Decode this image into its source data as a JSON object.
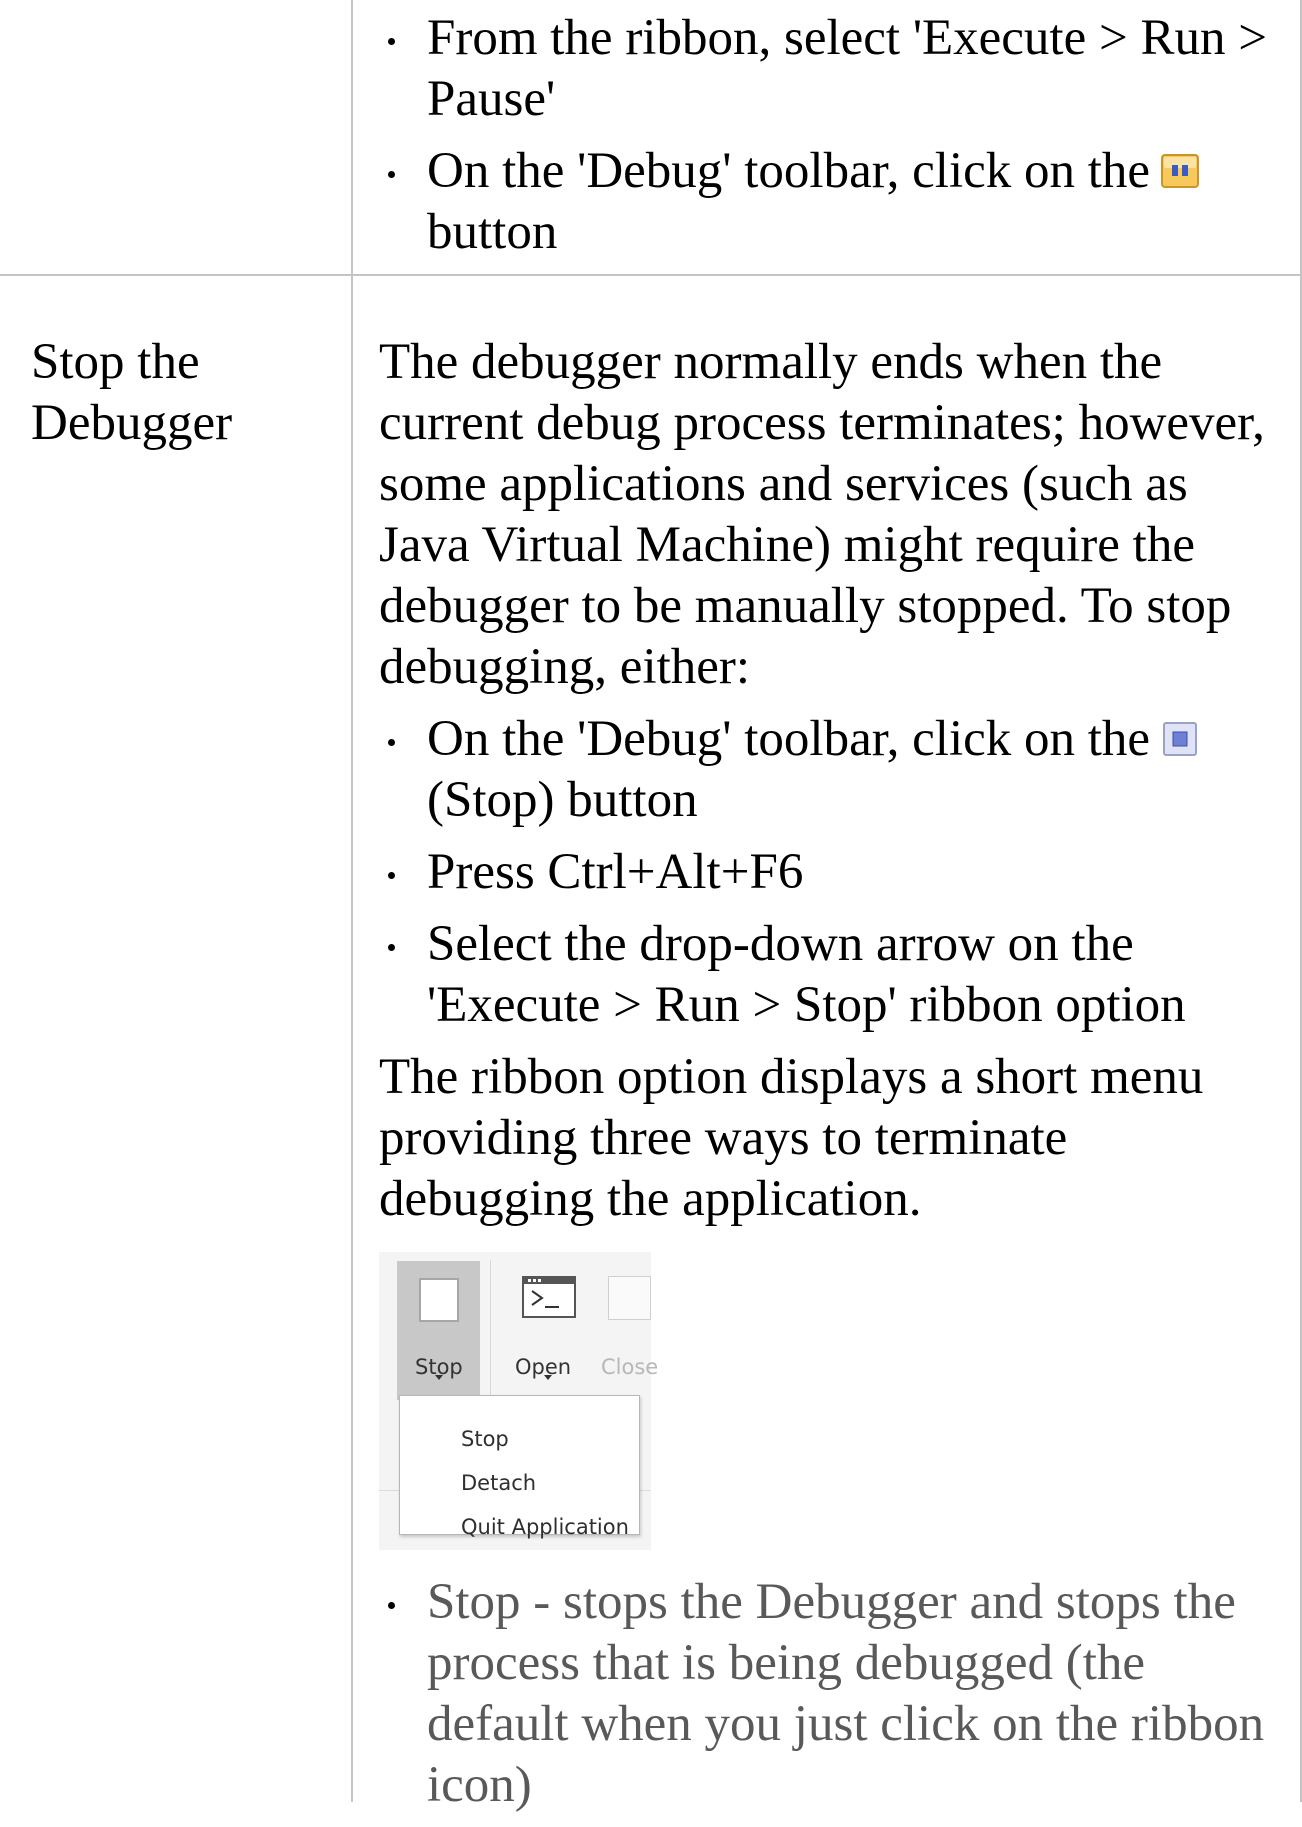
{
  "row1": {
    "bullets": [
      {
        "text": "From the ribbon, select 'Execute > Run > Pause'"
      },
      {
        "text_before": "On the 'Debug' toolbar, click on the",
        "icon": "pause-icon",
        "text_after": "button"
      }
    ]
  },
  "row2": {
    "label": "Stop the Debugger",
    "intro": "The debugger normally ends when the current debug process terminates; however, some applications and services (such as Java Virtual Machine) might require the debugger to be manually stopped. To stop debugging, either:",
    "bullets": [
      {
        "text_before": "On the 'Debug' toolbar, click on the",
        "icon": "stop-icon",
        "text_after": "(Stop) button"
      },
      {
        "text": "Press Ctrl+Alt+F6"
      },
      {
        "text": "Select the drop-down arrow on the 'Execute > Run > Stop' ribbon option"
      }
    ],
    "after": "The ribbon option displays a short menu providing three ways to terminate debugging the application.",
    "ribbon": {
      "stop_label": "Stop",
      "open_label": "Open",
      "close_label": "Close",
      "menu_items": [
        "Stop",
        "Detach",
        "Quit Application"
      ]
    },
    "post_bullets": [
      {
        "text": "Stop - stops the Debugger and stops the process that is being debugged (the default when you just click on the ribbon icon)"
      }
    ]
  },
  "colors": {
    "border": "#c4c4c4",
    "text": "#000000",
    "muted_text": "#595959",
    "pause_icon_fill": "#f6c95a",
    "stop_icon_fill": "#6d7fd6"
  }
}
